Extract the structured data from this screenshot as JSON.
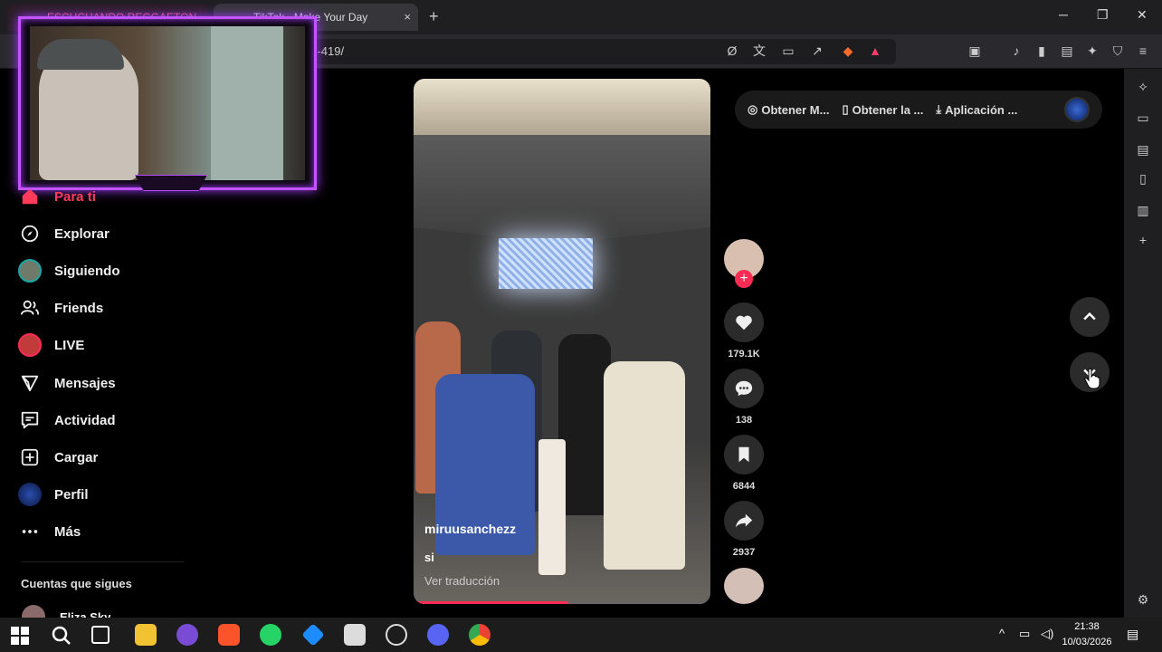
{
  "browser": {
    "tabs": [
      {
        "label": "ESCUCHANDO REGGAETON"
      },
      {
        "label": "TikTok - Make Your Day"
      }
    ],
    "url": "/...-419/",
    "new_tab": "+",
    "tab_close": "×",
    "window_controls": {
      "minimize": "─",
      "restore": "❐",
      "close": "✕"
    }
  },
  "sidebar": {
    "items": [
      {
        "label": "Para ti",
        "icon": "home-icon"
      },
      {
        "label": "Explorar",
        "icon": "compass-icon"
      },
      {
        "label": "Siguiendo",
        "icon": "following-avatar"
      },
      {
        "label": "Friends",
        "icon": "friends-icon"
      },
      {
        "label": "LIVE",
        "icon": "live-avatar"
      },
      {
        "label": "Mensajes",
        "icon": "send-icon"
      },
      {
        "label": "Actividad",
        "icon": "activity-icon"
      },
      {
        "label": "Cargar",
        "icon": "upload-icon"
      },
      {
        "label": "Perfil",
        "icon": "profile-avatar"
      },
      {
        "label": "Más",
        "icon": "more-icon"
      }
    ],
    "following_title": "Cuentas que sigues",
    "following": [
      {
        "name": "Eliza Sky"
      }
    ]
  },
  "video": {
    "username": "miruusanchezz",
    "caption": "si",
    "translate": "Ver traducción",
    "progress": 0.52
  },
  "actions": {
    "likes": "179.1K",
    "comments": "138",
    "saves": "6844",
    "shares": "2937",
    "follow": "+"
  },
  "get_bar": {
    "items": [
      "Obtener M...",
      "Obtener la ...",
      "Aplicación ..."
    ]
  },
  "taskbar": {
    "time": "21:38",
    "date": "10/03/2026"
  },
  "colors": {
    "accent": "#fe2c55",
    "cam_border": "#c255ff"
  }
}
